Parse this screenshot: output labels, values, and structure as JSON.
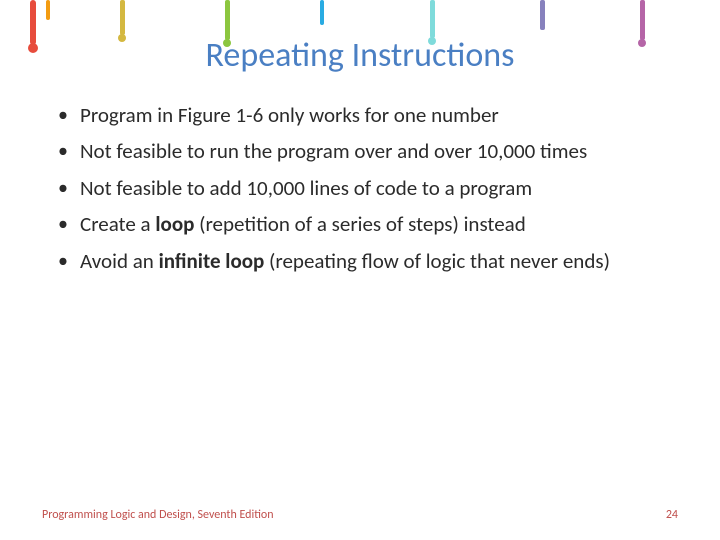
{
  "title": "Repeating Instructions",
  "bullets": {
    "b0": "Program in Figure 1-6 only works for one number",
    "b1": "Not feasible to run the program over and over 10,000 times",
    "b2": "Not feasible to add 10,000 lines of code to a program",
    "b3_pre": "Create a ",
    "b3_bold": "loop",
    "b3_post": " (repetition of a series of steps) instead",
    "b4_pre": "Avoid an ",
    "b4_bold": "infinite loop",
    "b4_post": " (repeating flow of logic that never ends)"
  },
  "footer": {
    "left": "Programming Logic and Design, Seventh Edition",
    "right": "24"
  }
}
